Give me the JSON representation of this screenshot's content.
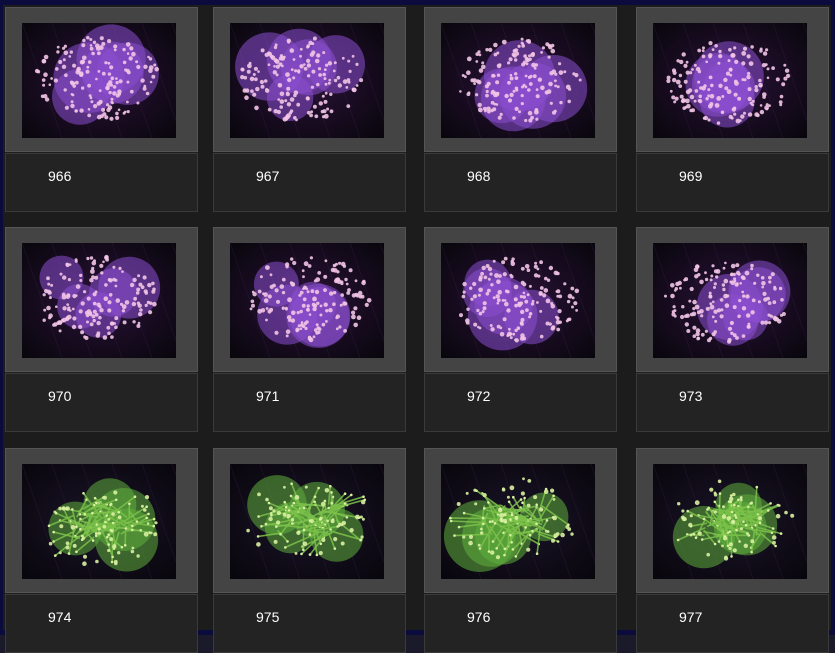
{
  "gallery": {
    "items": [
      {
        "label": "966",
        "coral": "purple"
      },
      {
        "label": "967",
        "coral": "purple"
      },
      {
        "label": "968",
        "coral": "purple"
      },
      {
        "label": "969",
        "coral": "purple"
      },
      {
        "label": "970",
        "coral": "purple"
      },
      {
        "label": "971",
        "coral": "purple"
      },
      {
        "label": "972",
        "coral": "purple"
      },
      {
        "label": "973",
        "coral": "purple"
      },
      {
        "label": "974",
        "coral": "green"
      },
      {
        "label": "975",
        "coral": "green"
      },
      {
        "label": "976",
        "coral": "green"
      },
      {
        "label": "977",
        "coral": "green"
      }
    ]
  },
  "colors": {
    "frame": "#0c0b3e",
    "tile": "#444444",
    "caption": "#232323",
    "purple_coral": "#8a4fd0",
    "purple_tips": "#f2c4e6",
    "green_coral": "#5fae3c",
    "green_tips": "#d8f0a0"
  }
}
